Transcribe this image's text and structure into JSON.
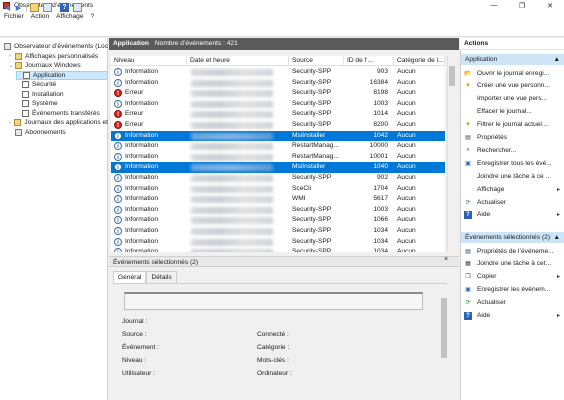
{
  "window": {
    "title": "Observateur d’événements"
  },
  "menu": [
    "Fichier",
    "Action",
    "Affichage",
    "?"
  ],
  "tree": [
    {
      "label": "Observateur d’événements (Loc",
      "level": 0,
      "arrow": "",
      "icon": "log-viewer"
    },
    {
      "label": "Affichages personnalisés",
      "level": 1,
      "arrow": ">",
      "icon": "folder"
    },
    {
      "label": "Journaux Windows",
      "level": 1,
      "arrow": "v",
      "icon": "folder"
    },
    {
      "label": "Application",
      "level": 2,
      "arrow": "",
      "icon": "log",
      "selected": true
    },
    {
      "label": "Sécurité",
      "level": 2,
      "arrow": "",
      "icon": "log"
    },
    {
      "label": "Installation",
      "level": 2,
      "arrow": "",
      "icon": "log"
    },
    {
      "label": "Système",
      "level": 2,
      "arrow": "",
      "icon": "log"
    },
    {
      "label": "Événements transférés",
      "level": 2,
      "arrow": "",
      "icon": "log"
    },
    {
      "label": "Journaux des applications et",
      "level": 1,
      "arrow": ">",
      "icon": "folder"
    },
    {
      "label": "Abonnements",
      "level": 1,
      "arrow": "",
      "icon": "subscription"
    }
  ],
  "center": {
    "log_name": "Application",
    "count_label": "Nombre d’événements : 421"
  },
  "columns": [
    "Niveau",
    "Date et heure",
    "Source",
    "ID de l’...",
    "Catégorie de l..."
  ],
  "events": [
    {
      "level": "Information",
      "source": "Security-SPP",
      "id": "903",
      "category": "Aucun"
    },
    {
      "level": "Information",
      "source": "Security-SPP",
      "id": "16384",
      "category": "Aucun"
    },
    {
      "level": "Erreur",
      "source": "Security-SPP",
      "id": "8198",
      "category": "Aucun"
    },
    {
      "level": "Information",
      "source": "Security-SPP",
      "id": "1003",
      "category": "Aucun"
    },
    {
      "level": "Erreur",
      "source": "Security-SPP",
      "id": "1014",
      "category": "Aucun"
    },
    {
      "level": "Erreur",
      "source": "Security-SPP",
      "id": "8200",
      "category": "Aucun"
    },
    {
      "level": "Information",
      "source": "MsiInstaller",
      "id": "1042",
      "category": "Aucun",
      "selected": true
    },
    {
      "level": "Information",
      "source": "RestartManag...",
      "id": "10000",
      "category": "Aucun"
    },
    {
      "level": "Information",
      "source": "RestartManag...",
      "id": "10001",
      "category": "Aucun"
    },
    {
      "level": "Information",
      "source": "MsiInstaller",
      "id": "1040",
      "category": "Aucun",
      "selected": true
    },
    {
      "level": "Information",
      "source": "Security-SPP",
      "id": "902",
      "category": "Aucun"
    },
    {
      "level": "Information",
      "source": "SceCli",
      "id": "1704",
      "category": "Aucun"
    },
    {
      "level": "Information",
      "source": "WMI",
      "id": "5617",
      "category": "Aucun"
    },
    {
      "level": "Information",
      "source": "Security-SPP",
      "id": "1003",
      "category": "Aucun"
    },
    {
      "level": "Information",
      "source": "Security-SPP",
      "id": "1066",
      "category": "Aucun"
    },
    {
      "level": "Information",
      "source": "Security-SPP",
      "id": "1034",
      "category": "Aucun"
    },
    {
      "level": "Information",
      "source": "Security-SPP",
      "id": "1034",
      "category": "Aucun"
    },
    {
      "level": "Information",
      "source": "Security-SPP",
      "id": "1034",
      "category": "Aucun"
    }
  ],
  "details": {
    "header": "Événements sélectionnés (2)",
    "close": "×",
    "tabs": [
      "Général",
      "Détails"
    ],
    "fields_left": [
      "Journal :",
      "Source :",
      "Événement :",
      "Niveau :",
      "Utilisateur :"
    ],
    "fields_right": [
      "Connecté :",
      "Catégorie :",
      "Mots-clés :",
      "Ordinateur :"
    ]
  },
  "actions": {
    "title": "Actions",
    "section1": "Application",
    "section1_items": [
      {
        "label": "Ouvrir le journal enregi...",
        "icon": "folder-open-icon",
        "arrow": ""
      },
      {
        "label": "Créer une vue personn...",
        "icon": "filter-create-icon",
        "arrow": ""
      },
      {
        "label": "Importer une vue pers...",
        "icon": "",
        "arrow": ""
      },
      {
        "label": "Effacer le journal...",
        "icon": "",
        "arrow": ""
      },
      {
        "label": "Filtrer le journal actuel...",
        "icon": "filter-icon",
        "arrow": ""
      },
      {
        "label": "Propriétés",
        "icon": "properties-icon",
        "arrow": ""
      },
      {
        "label": "Rechercher...",
        "icon": "find-icon",
        "arrow": ""
      },
      {
        "label": "Enregistrer tous les évé...",
        "icon": "save-icon",
        "arrow": ""
      },
      {
        "label": "Joindre une tâche à ce ...",
        "icon": "",
        "arrow": ""
      },
      {
        "label": "Affichage",
        "icon": "",
        "arrow": ">"
      },
      {
        "label": "Actualiser",
        "icon": "refresh-icon",
        "arrow": ""
      },
      {
        "label": "Aide",
        "icon": "help-icon",
        "arrow": ">"
      }
    ],
    "section2": "Événements sélectionnés (2)",
    "section2_items": [
      {
        "label": "Propriétés de l’événeme...",
        "icon": "event-properties-icon",
        "arrow": ""
      },
      {
        "label": "Joindre une tâche à cet...",
        "icon": "task-icon",
        "arrow": ""
      },
      {
        "label": "Copier",
        "icon": "copy-icon",
        "arrow": ">"
      },
      {
        "label": "Enregistrer les événem...",
        "icon": "save-icon",
        "arrow": ""
      },
      {
        "label": "Actualiser",
        "icon": "refresh-icon",
        "arrow": ""
      },
      {
        "label": "Aide",
        "icon": "help-icon",
        "arrow": ">"
      }
    ]
  },
  "colors": {
    "selection": "#0078d7",
    "header_dark": "#5a5a5a",
    "section_blue": "#cde3f6",
    "error_red": "#d7261e"
  }
}
